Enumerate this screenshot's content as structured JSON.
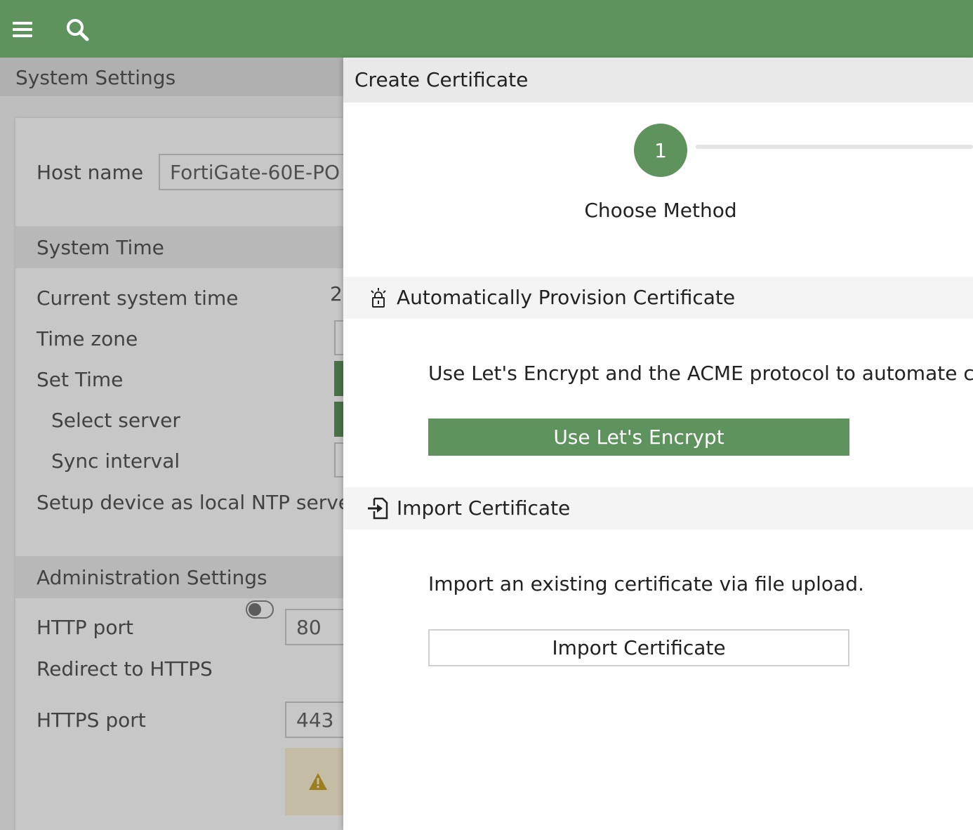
{
  "topbar": {
    "menu_icon": "hamburger-menu-icon",
    "search_icon": "search-icon",
    "background_color": "#5e935d"
  },
  "background_page": {
    "title": "System Settings",
    "host_name_label": "Host name",
    "host_name_value": "FortiGate-60E-PO",
    "system_time_section": "System Time",
    "current_system_time_label": "Current system time",
    "current_system_time_value": "2",
    "time_zone_label": "Time zone",
    "set_time_label": "Set Time",
    "select_server_label": "Select server",
    "sync_interval_label": "Sync interval",
    "ntp_server_label": "Setup device as local NTP server",
    "admin_section": "Administration Settings",
    "http_port_label": "HTTP port",
    "http_port_value": "80",
    "redirect_https_label": "Redirect to HTTPS",
    "https_port_label": "HTTPS port",
    "https_port_value": "443",
    "warning_icon": "warning-icon"
  },
  "panel": {
    "title": "Create Certificate",
    "step": {
      "number": "1",
      "label": "Choose Method"
    },
    "auto_section": {
      "icon": "certificate-lock-icon",
      "title": "Automatically Provision Certificate",
      "description": "Use Let's Encrypt and the ACME protocol to automate certificate",
      "button_label": "Use Let's Encrypt"
    },
    "import_section": {
      "icon": "file-import-icon",
      "title": "Import Certificate",
      "description": "Import an existing certificate via file upload.",
      "button_label": "Import Certificate"
    }
  },
  "colors": {
    "accent": "#5e935d",
    "header_bg": "#e9e9e9",
    "section_bg": "#f4f4f4"
  }
}
